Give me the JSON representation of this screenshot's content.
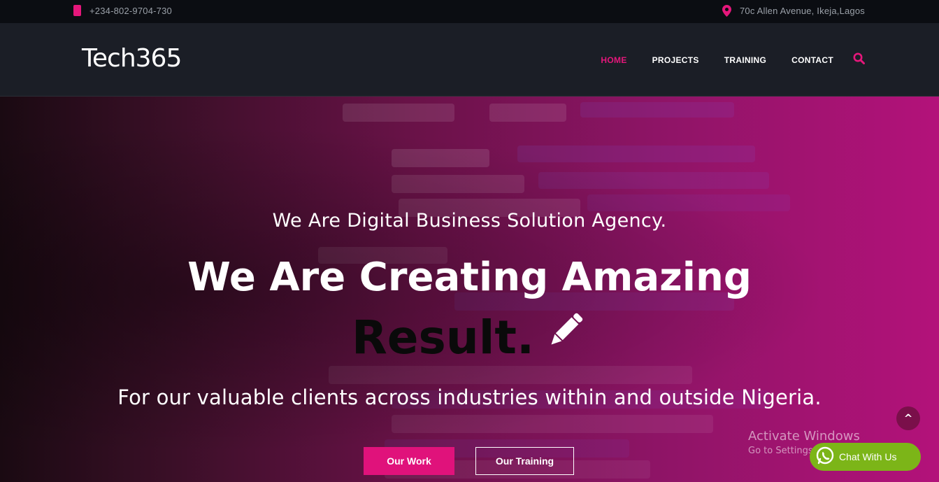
{
  "topbar": {
    "phone": "+234-802-9704-730",
    "address": "70c Allen Avenue, Ikeja,Lagos"
  },
  "header": {
    "logo": "Tech365",
    "nav": [
      {
        "label": "HOME",
        "active": true
      },
      {
        "label": "PROJECTS",
        "active": false
      },
      {
        "label": "TRAINING",
        "active": false
      },
      {
        "label": "CONTACT",
        "active": false
      }
    ]
  },
  "hero": {
    "subtitle": "We Are Digital Business Solution Agency.",
    "headline": "We Are Creating Amazing",
    "headline_accent": "Result.",
    "tagline": "For our valuable clients across industries within and outside Nigeria.",
    "buttons": {
      "work": "Our Work",
      "training": "Our Training"
    }
  },
  "overlay": {
    "scroll_top": "^",
    "activate_title": "Activate Windows",
    "activate_sub": "Go to Settings to activate Windows.",
    "chat": "Chat With Us"
  },
  "colors": {
    "accent": "#e5177b",
    "nav_bg": "#1b1e26",
    "topbar_bg": "#0b0d12",
    "chat_green": "#7cb518"
  },
  "icons": [
    "phone-icon",
    "map-pin-icon",
    "search-icon",
    "pencil-icon",
    "whatsapp-icon"
  ]
}
